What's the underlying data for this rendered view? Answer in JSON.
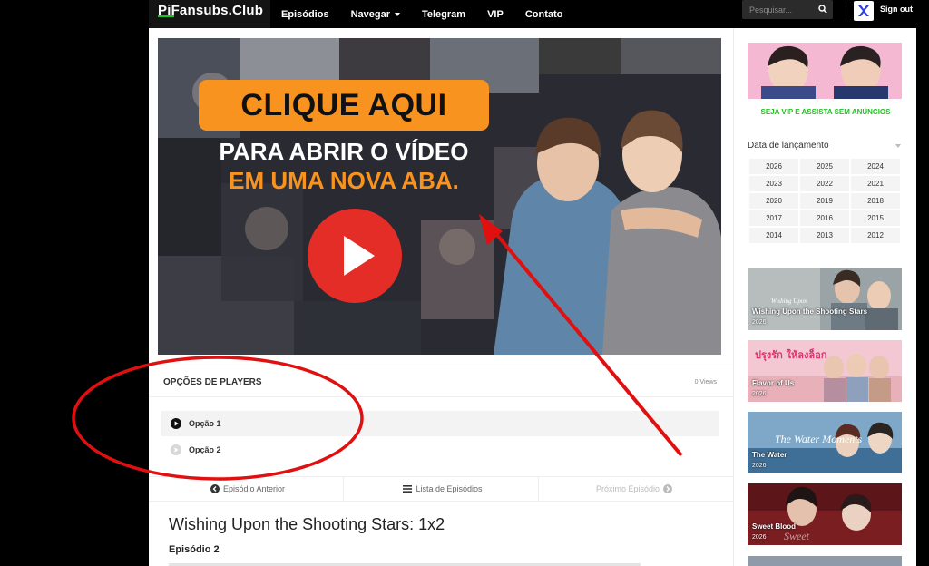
{
  "header": {
    "logo": "PiFansubs.Club",
    "nav": [
      "Episódios",
      "Navegar",
      "Telegram",
      "VIP",
      "Contato"
    ],
    "search_placeholder": "Pesquisar...",
    "signout": "Sign out"
  },
  "video": {
    "cta_box": "CLIQUE AQUI",
    "cta_line1": "PARA ABRIR O VÍDEO",
    "cta_line2": "EM UMA NOVA ABA."
  },
  "players": {
    "title": "OPÇÕES DE PLAYERS",
    "views": "0 Views",
    "options": [
      "Opção 1",
      "Opção 2"
    ]
  },
  "episode_nav": {
    "prev": "Episódio Anterior",
    "list": "Lista de Episódios",
    "next": "Próximo Episódio"
  },
  "episode": {
    "title": "Wishing Upon the Shooting Stars: 1x2",
    "subtitle": "Episódio 2"
  },
  "sidebar": {
    "vip_text": "SEJA VIP E ASSISTA SEM ANÚNCIOS",
    "release_title": "Data de lançamento",
    "years": [
      "2026",
      "2025",
      "2024",
      "2023",
      "2022",
      "2021",
      "2020",
      "2019",
      "2018",
      "2017",
      "2016",
      "2015",
      "2014",
      "2013",
      "2012"
    ],
    "cards": [
      {
        "overlay": "Wishing Upon",
        "title": "Wishing Upon the Shooting Stars",
        "year": "2026"
      },
      {
        "overlay": "ปรุงรัก ให้ลงล็อก",
        "title": "Flavor of Us",
        "year": "2026"
      },
      {
        "overlay": "The Water Moments",
        "title": "The Water",
        "year": "2026"
      },
      {
        "overlay": "Sweet",
        "title": "Sweet Blood",
        "year": "2026"
      }
    ]
  },
  "colors": {
    "accent_green": "#1ec31e",
    "cta_orange": "#f7931e",
    "play_red": "#e52d27",
    "annotation_red": "#e01010"
  }
}
